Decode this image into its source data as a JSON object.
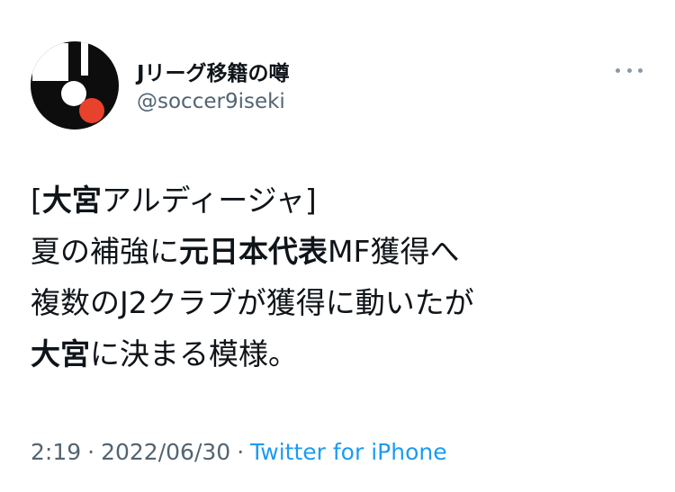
{
  "user": {
    "display_name": "Jリーグ移籍の噂",
    "handle": "@soccer9iseki"
  },
  "more_menu_icon": "more-horizontal-icon",
  "tweet": {
    "line1": {
      "open_bracket": "[",
      "bold": "大宮",
      "rest": "アルディージャ]"
    },
    "line2": {
      "pre": "夏の補強に",
      "bold": "元日本代表",
      "post": "MF獲得へ"
    },
    "line3": "複数のJ2クラブが獲得に動いたが",
    "line4": {
      "bold": "大宮",
      "post": "に決まる模様。"
    }
  },
  "meta": {
    "time": "2:19",
    "separator": "·",
    "date": "2022/06/30",
    "source": "Twitter for iPhone"
  },
  "colors": {
    "link": "#1d9bf0",
    "secondary_text": "#536471",
    "avatar_red": "#e8412c"
  }
}
